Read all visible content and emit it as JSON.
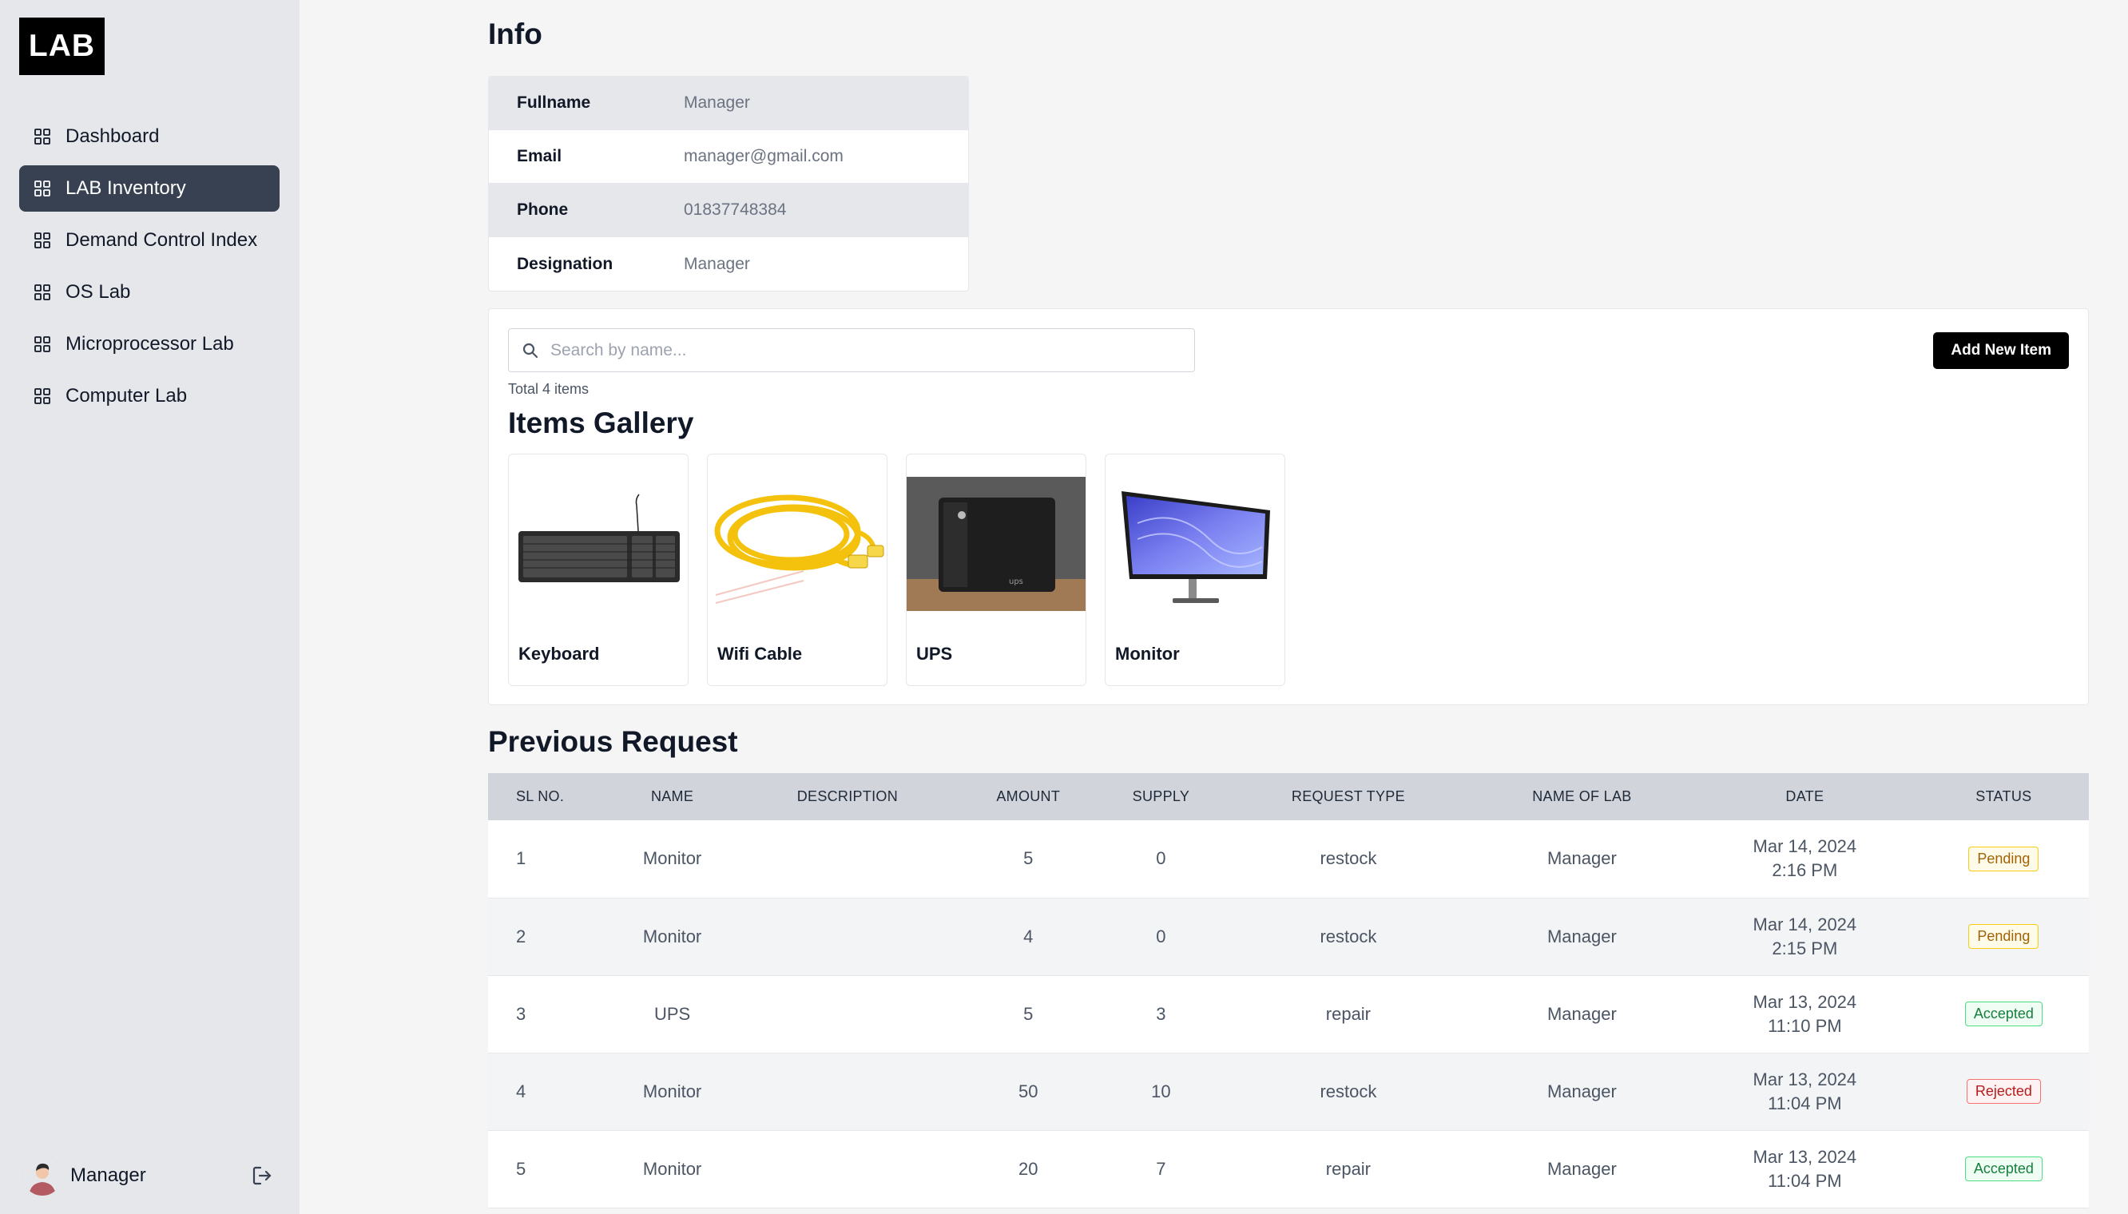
{
  "app": {
    "logo": "LAB"
  },
  "sidebar": {
    "items": [
      {
        "label": "Dashboard",
        "icon": "grid-icon",
        "active": false
      },
      {
        "label": "LAB Inventory",
        "icon": "grid-icon",
        "active": true
      },
      {
        "label": "Demand Control Index",
        "icon": "grid-icon",
        "active": false
      },
      {
        "label": "OS Lab",
        "icon": "grid-icon",
        "active": false
      },
      {
        "label": "Microprocessor Lab",
        "icon": "grid-icon",
        "active": false
      },
      {
        "label": "Computer Lab",
        "icon": "grid-icon",
        "active": false
      }
    ],
    "user": {
      "name": "Manager",
      "logout_icon": "logout-icon"
    }
  },
  "info": {
    "title": "Info",
    "rows": [
      {
        "label": "Fullname",
        "value": "Manager"
      },
      {
        "label": "Email",
        "value": "manager@gmail.com"
      },
      {
        "label": "Phone",
        "value": "01837748384"
      },
      {
        "label": "Designation",
        "value": "Manager"
      }
    ]
  },
  "gallery": {
    "search_placeholder": "Search by name...",
    "total_text": "Total 4 items",
    "add_button": "Add New Item",
    "title": "Items Gallery",
    "items": [
      {
        "name": "Keyboard",
        "icon": "keyboard-image"
      },
      {
        "name": "Wifi Cable",
        "icon": "cable-image"
      },
      {
        "name": "UPS",
        "icon": "ups-image"
      },
      {
        "name": "Monitor",
        "icon": "monitor-image"
      }
    ]
  },
  "requests": {
    "title": "Previous Request",
    "columns": [
      "SL NO.",
      "NAME",
      "DESCRIPTION",
      "AMOUNT",
      "SUPPLY",
      "REQUEST TYPE",
      "NAME OF LAB",
      "DATE",
      "STATUS"
    ],
    "rows": [
      {
        "sl": "1",
        "name": "Monitor",
        "description": "",
        "amount": "5",
        "supply": "0",
        "type": "restock",
        "lab": "Manager",
        "date": "Mar 14, 2024",
        "time": "2:16 PM",
        "status": "Pending"
      },
      {
        "sl": "2",
        "name": "Monitor",
        "description": "",
        "amount": "4",
        "supply": "0",
        "type": "restock",
        "lab": "Manager",
        "date": "Mar 14, 2024",
        "time": "2:15 PM",
        "status": "Pending"
      },
      {
        "sl": "3",
        "name": "UPS",
        "description": "",
        "amount": "5",
        "supply": "3",
        "type": "repair",
        "lab": "Manager",
        "date": "Mar 13, 2024",
        "time": "11:10 PM",
        "status": "Accepted"
      },
      {
        "sl": "4",
        "name": "Monitor",
        "description": "",
        "amount": "50",
        "supply": "10",
        "type": "restock",
        "lab": "Manager",
        "date": "Mar 13, 2024",
        "time": "11:04 PM",
        "status": "Rejected"
      },
      {
        "sl": "5",
        "name": "Monitor",
        "description": "",
        "amount": "20",
        "supply": "7",
        "type": "repair",
        "lab": "Manager",
        "date": "Mar 13, 2024",
        "time": "11:04 PM",
        "status": "Accepted"
      }
    ]
  },
  "colors": {
    "sidebar_bg": "#e5e7eb",
    "active_nav": "#374151",
    "pending": "#a16207",
    "accepted": "#15803d",
    "rejected": "#b91c1c"
  }
}
